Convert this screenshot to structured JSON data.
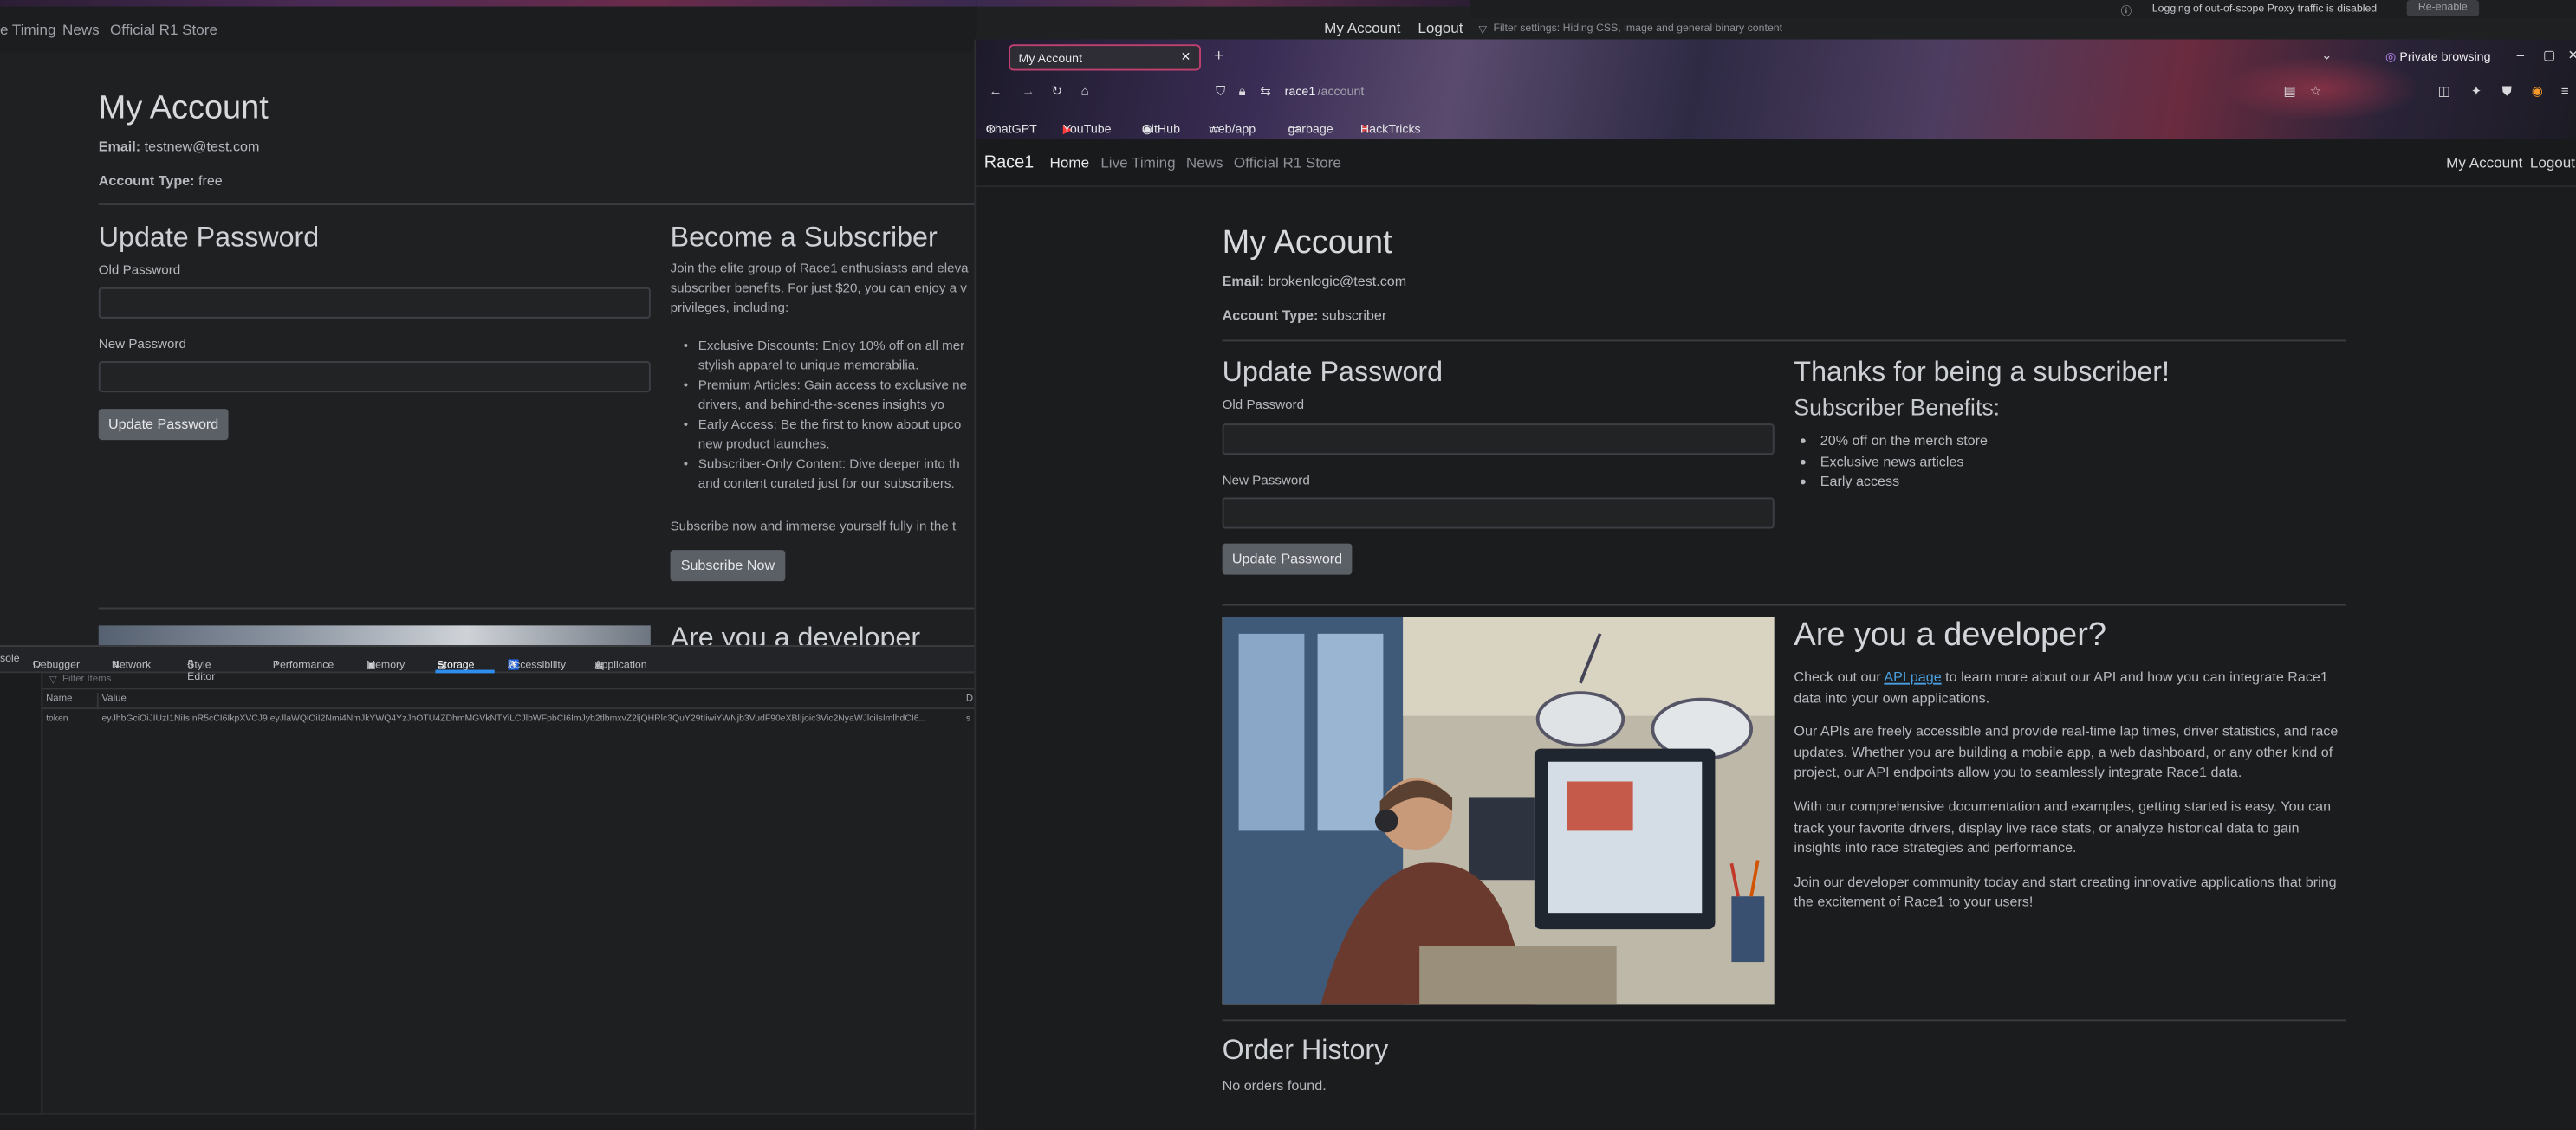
{
  "left_window": {
    "nav": {
      "timing": "e Timing",
      "news": "News",
      "store": "Official R1 Store"
    },
    "account": {
      "title": "My Account",
      "email_label": "Email:",
      "email_value": "testnew@test.com",
      "type_label": "Account Type:",
      "type_value": "free"
    },
    "update_password": {
      "title": "Update Password",
      "old_label": "Old Password",
      "new_label": "New Password",
      "button": "Update Password"
    },
    "subscriber": {
      "title": "Become a Subscriber",
      "intro_1": "Join the elite group of Race1 enthusiasts and eleva",
      "intro_2": "subscriber benefits. For just $20, you can enjoy a v",
      "intro_3": "privileges, including:",
      "bullets": [
        {
          "l1": "Exclusive Discounts: Enjoy 10% off on all mer",
          "l2": "stylish apparel to unique memorabilia."
        },
        {
          "l1": "Premium Articles: Gain access to exclusive ne",
          "l2": "drivers, and behind-the-scenes insights yo"
        },
        {
          "l1": "Early Access: Be the first to know about upco",
          "l2": "new product launches."
        },
        {
          "l1": "Subscriber-Only Content: Dive deeper into th",
          "l2": "and content curated just for our subscribers."
        }
      ],
      "outro": "Subscribe now and immerse yourself fully in the t",
      "button": "Subscribe Now"
    },
    "developer_peek": "Are you a developer",
    "devtools": {
      "tabs": [
        "sole",
        "Debugger",
        "Network",
        "Style Editor",
        "Performance",
        "Memory",
        "Storage",
        "Accessibility",
        "Application"
      ],
      "active_tab": "Storage",
      "filter_placeholder": "Filter Items",
      "col_name": "Name",
      "col_value": "Value",
      "col_extra": "D",
      "row_name": "token",
      "row_value": "eyJhbGciOiJIUzI1NiIsInR5cCI6IkpXVCJ9.eyJlaWQiOiI2Nmi4NmJkYWQ4YzJhOTU4ZDhmMGVkNTYiLCJlbWFpbCI6ImJyb2tlbmxvZ2ljQHRlc3QuY29tIiwiYWNjb3VudF90eXBlIjoic3Vic2NyaWJlciIsImlhdCI6...",
      "row_extra": "s"
    }
  },
  "burp": {
    "message": "Logging of out-of-scope Proxy traffic is disabled",
    "button": "Re-enable",
    "filter": "Filter settings: Hiding CSS, image and general binary content"
  },
  "browser": {
    "tab_title": "My Account",
    "private_label": "Private browsing",
    "url_host": "race1",
    "url_path": "/account",
    "bookmarks": [
      "ChatGPT",
      "YouTube",
      "GitHub",
      "web/app",
      "garbage",
      "HackTricks | HackTricks"
    ],
    "site_nav": {
      "brand": "Race1",
      "home": "Home",
      "timing": "Live Timing",
      "news": "News",
      "store": "Official R1 Store",
      "account": "My Account",
      "logout": "Logout"
    },
    "account": {
      "title": "My Account",
      "email_label": "Email:",
      "email_value": "brokenlogic@test.com",
      "type_label": "Account Type:",
      "type_value": "subscriber"
    },
    "update_password": {
      "title": "Update Password",
      "old_label": "Old Password",
      "new_label": "New Password",
      "button": "Update Password"
    },
    "subscriber": {
      "title": "Thanks for being a subscriber!",
      "benefits_title": "Subscriber Benefits:",
      "benefits": [
        "20% off on the merch store",
        "Exclusive news articles",
        "Early access"
      ]
    },
    "developer": {
      "title": "Are you a developer?",
      "p1_pre": "Check out our ",
      "p1_link": "API page",
      "p1_post": " to learn more about our API and how you can integrate Race1 data into your own applications.",
      "p2": "Our APIs are freely accessible and provide real-time lap times, driver statistics, and race updates. Whether you are building a mobile app, a web dashboard, or any other kind of project, our API endpoints allow you to seamlessly integrate Race1 data.",
      "p3": "With our comprehensive documentation and examples, getting started is easy. You can track your favorite drivers, display live race stats, or analyze historical data to gain insights into race strategies and performance.",
      "p4": "Join our developer community today and start creating innovative applications that bring the excitement of Race1 to your users!"
    },
    "orders": {
      "title": "Order History",
      "empty": "No orders found."
    }
  },
  "top_nav_overlap": {
    "account": "My Account",
    "logout": "Logout"
  },
  "colors": {
    "background": "#1b1c1e",
    "accent_tab": "#c04070",
    "link": "#4a9fe0",
    "button": "#5b5f66"
  }
}
